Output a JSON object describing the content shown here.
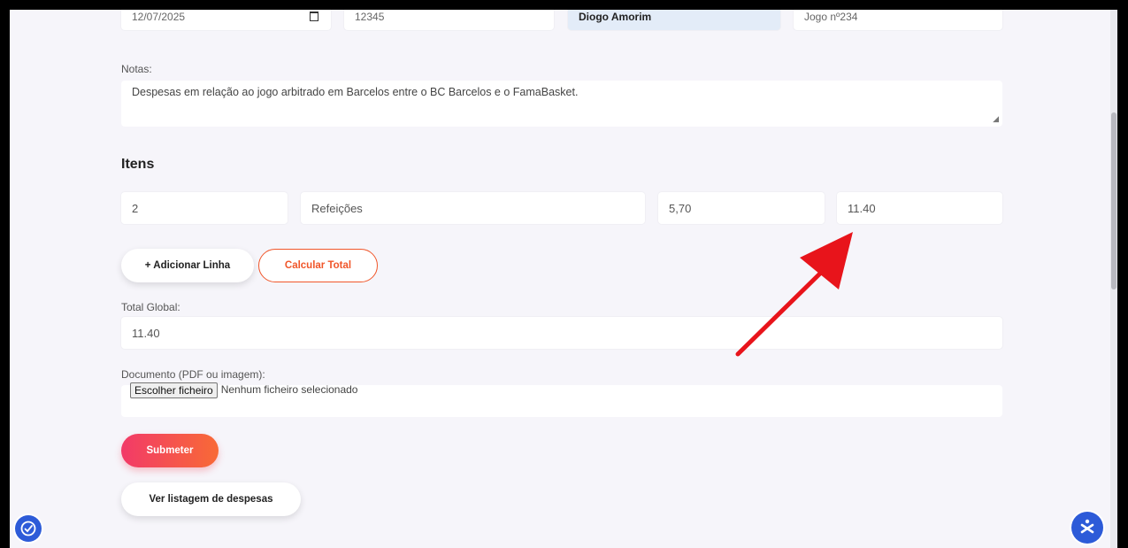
{
  "top_row": {
    "date_value": "12/07/2025",
    "number_value": "12345",
    "name_value": "Diogo Amorim",
    "game_value": "Jogo nº234"
  },
  "notes": {
    "label": "Notas:",
    "value": "Despesas em relação ao jogo arbitrado em Barcelos entre o BC Barcelos e o FamaBasket."
  },
  "items": {
    "title": "Itens",
    "row": {
      "quantity": "2",
      "description": "Refeições",
      "unit_price": "5,70",
      "total": "11.40"
    }
  },
  "buttons": {
    "add_line": "+ Adicionar Linha",
    "calculate_total": "Calcular Total",
    "submit": "Submeter",
    "view_list": "Ver listagem de despesas"
  },
  "total": {
    "label": "Total Global:",
    "value": "11.40"
  },
  "document": {
    "label": "Documento (PDF ou imagem):",
    "choose_button": "Escolher ficheiro",
    "status": "Nenhum ficheiro selecionado"
  },
  "colors": {
    "accent": "#f0562a",
    "submit_gradient_start": "#f23a68",
    "submit_gradient_end": "#f86a36",
    "fab_blue": "#2d5bd8",
    "annotation_arrow": "#e8141b"
  },
  "icons": {
    "left_fab": "clock-check-icon",
    "right_fab": "accessibility-icon",
    "annotation": "red-arrow-icon"
  }
}
